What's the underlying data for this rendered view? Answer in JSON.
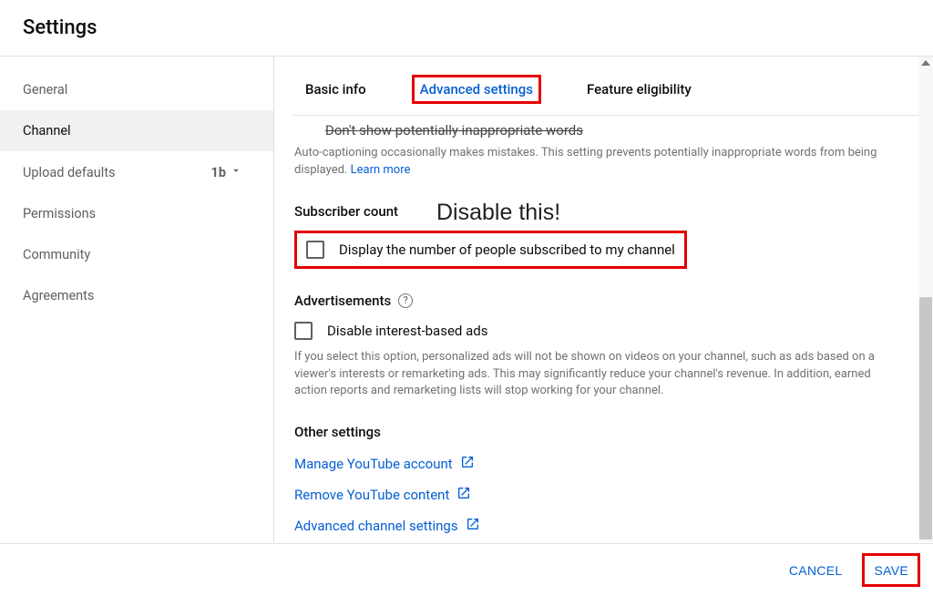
{
  "page_title": "Settings",
  "sidebar": {
    "items": [
      {
        "label": "General"
      },
      {
        "label": "Channel"
      },
      {
        "label": "Upload defaults",
        "badge": "1b"
      },
      {
        "label": "Permissions"
      },
      {
        "label": "Community"
      },
      {
        "label": "Agreements"
      }
    ],
    "active_index": 1
  },
  "tabs": {
    "items": [
      {
        "label": "Basic info"
      },
      {
        "label": "Advanced settings"
      },
      {
        "label": "Feature eligibility"
      }
    ],
    "active_index": 1
  },
  "truncated": {
    "label": "Don't show potentially inappropriate words",
    "helper": "Auto-captioning occasionally makes mistakes. This setting prevents potentially inappropriate words from being displayed.",
    "learn_more": "Learn more"
  },
  "subscriber": {
    "heading": "Subscriber count",
    "checkbox_label": "Display the number of people subscribed to my channel"
  },
  "annotation": "Disable this!",
  "ads": {
    "heading": "Advertisements",
    "checkbox_label": "Disable interest-based ads",
    "helper": "If you select this option, personalized ads will not be shown on videos on your channel, such as ads based on a viewer's interests or remarketing ads. This may significantly reduce your channel's revenue. In addition, earned action reports and remarketing lists will stop working for your channel."
  },
  "other": {
    "heading": "Other settings",
    "links": [
      "Manage YouTube account",
      "Remove YouTube content",
      "Advanced channel settings"
    ]
  },
  "footer": {
    "cancel": "CANCEL",
    "save": "SAVE"
  }
}
